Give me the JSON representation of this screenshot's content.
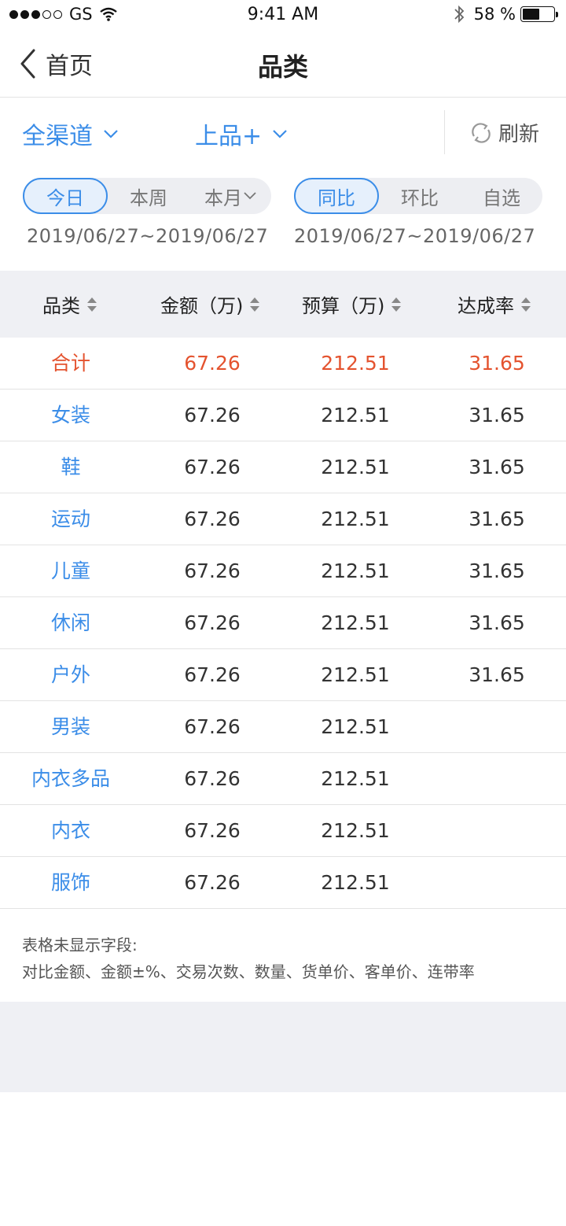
{
  "status_bar": {
    "carrier": "GS",
    "time": "9:41 AM",
    "battery": "58 %",
    "battery_level": 0.58
  },
  "nav": {
    "back_label": "首页",
    "title": "品类"
  },
  "filters": {
    "channel": "全渠道",
    "category": "上品+",
    "refresh": "刷新"
  },
  "period_tabs": [
    {
      "label": "今日",
      "active": true
    },
    {
      "label": "本周",
      "active": false
    },
    {
      "label": "本月",
      "active": false
    }
  ],
  "compare_tabs": [
    {
      "label": "同比",
      "active": true
    },
    {
      "label": "环比",
      "active": false
    },
    {
      "label": "自选",
      "active": false
    }
  ],
  "date_range_left": "2019/06/27~2019/06/27",
  "date_range_right": "2019/06/27~2019/06/27",
  "table": {
    "headers": [
      "品类",
      "金额（万)",
      "预算（万)",
      "达成率"
    ],
    "rows": [
      {
        "name": "合计",
        "amount": "67.26",
        "budget": "212.51",
        "rate": "31.65"
      },
      {
        "name": "女装",
        "amount": "67.26",
        "budget": "212.51",
        "rate": "31.65"
      },
      {
        "name": "鞋",
        "amount": "67.26",
        "budget": "212.51",
        "rate": "31.65"
      },
      {
        "name": "运动",
        "amount": "67.26",
        "budget": "212.51",
        "rate": "31.65"
      },
      {
        "name": "儿童",
        "amount": "67.26",
        "budget": "212.51",
        "rate": "31.65"
      },
      {
        "name": "休闲",
        "amount": "67.26",
        "budget": "212.51",
        "rate": "31.65"
      },
      {
        "name": "户外",
        "amount": "67.26",
        "budget": "212.51",
        "rate": "31.65"
      },
      {
        "name": "男装",
        "amount": "67.26",
        "budget": "212.51",
        "rate": ""
      },
      {
        "name": "内衣多品",
        "amount": "67.26",
        "budget": "212.51",
        "rate": ""
      },
      {
        "name": "内衣",
        "amount": "67.26",
        "budget": "212.51",
        "rate": ""
      },
      {
        "name": "服饰",
        "amount": "67.26",
        "budget": "212.51",
        "rate": ""
      }
    ]
  },
  "note": {
    "title": "表格未显示字段:",
    "text": "对比金额、金额±%、交易次数、数量、货单价、客单价、连带率"
  },
  "colors": {
    "accent": "#3b8de8",
    "total_red": "#e4532f",
    "header_bg": "#eff0f4"
  }
}
